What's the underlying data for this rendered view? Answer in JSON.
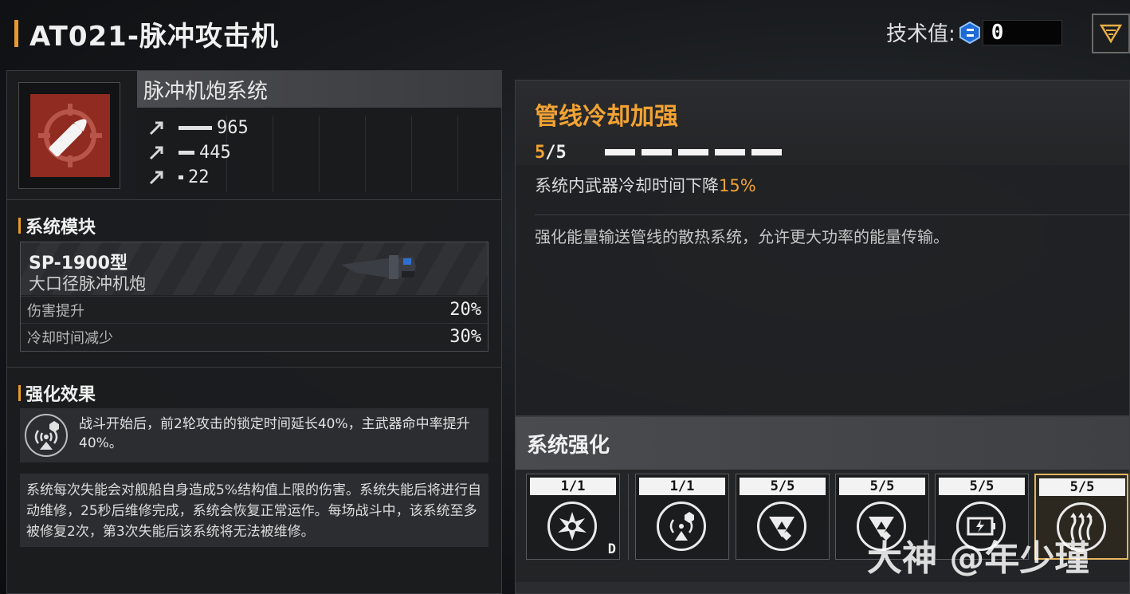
{
  "header": {
    "title": "AT021-脉冲攻击机",
    "tech_label": "技术值:",
    "tech_value": "0"
  },
  "weapon": {
    "system_name": "脉冲机炮系统",
    "stats": [
      {
        "icon": "arrow-up-icon",
        "value": "965",
        "fill": 0.42
      },
      {
        "icon": "arrow-up-icon",
        "value": "445",
        "fill": 0.2
      },
      {
        "icon": "arrow-up-icon",
        "value": "22",
        "fill": 0.04
      }
    ]
  },
  "module_section": {
    "title": "系统模块",
    "name": "SP-1900型",
    "subtitle": "大口径脉冲机炮",
    "rows": [
      {
        "label": "伤害提升",
        "value": "20%"
      },
      {
        "label": "冷却时间减少",
        "value": "30%"
      }
    ]
  },
  "enhance_section": {
    "title": "强化效果",
    "effect_text": "战斗开始后，前2轮攻击的锁定时间延长40%，主武器命中率提升40%。",
    "note_text": "系统每次失能会对舰船自身造成5%结构值上限的伤害。系统失能后将进行自动维修，25秒后维修完成，系统会恢复正常运作。每场战斗中，该系统至多被修复2次，第3次失能后该系统将无法被维修。"
  },
  "detail": {
    "title": "管线冷却加强",
    "level_current": "5",
    "level_sep": "/",
    "level_max": "5",
    "pips_filled": 5,
    "effect_prefix": "系统内武器冷却时间下降",
    "effect_value": "15%",
    "description": "强化能量输送管线的散热系统，允许更大功率的能量传输。"
  },
  "upgrades": {
    "title": "系统强化",
    "slots": [
      {
        "level": "1/1",
        "icon": "burst-icon",
        "tag": "D",
        "selected": false
      },
      {
        "level": "1/1",
        "icon": "radar-lock-icon",
        "tag": "",
        "selected": false
      },
      {
        "level": "5/5",
        "icon": "damage-up-icon",
        "tag": "",
        "selected": false
      },
      {
        "level": "5/5",
        "icon": "damage-up-icon",
        "tag": "",
        "selected": false
      },
      {
        "level": "5/5",
        "icon": "energy-cell-icon",
        "tag": "",
        "selected": false
      },
      {
        "level": "5/5",
        "icon": "heat-vent-icon",
        "tag": "",
        "selected": true
      }
    ]
  },
  "watermark": "大神 @年少瑾",
  "colors": {
    "accent": "#f3a332",
    "weapon_icon_bg": "#8f2b20"
  }
}
